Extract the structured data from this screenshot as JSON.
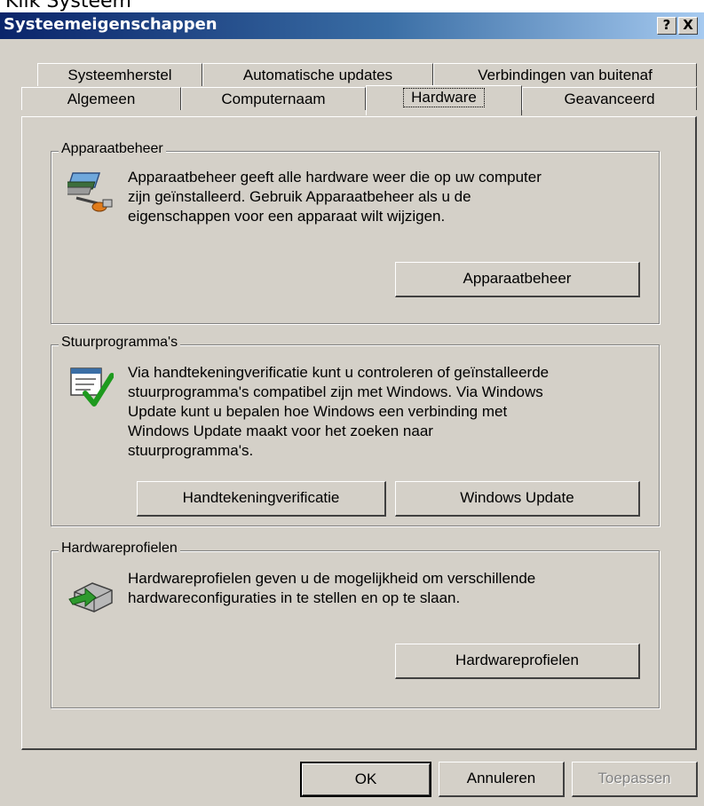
{
  "caption_fragment": "Klik Systeem",
  "window": {
    "title": "Systeemeigenschappen",
    "help_glyph": "?",
    "close_glyph": "X"
  },
  "tabs": {
    "row_back": [
      "Systeemherstel",
      "Automatische updates",
      "Verbindingen van buitenaf"
    ],
    "row_front": [
      "Algemeen",
      "Computernaam",
      "Hardware",
      "Geavanceerd"
    ],
    "active": "Hardware"
  },
  "device_manager": {
    "legend": "Apparaatbeheer",
    "icon": "device-manager-icon",
    "text_lines": [
      "Apparaatbeheer geeft alle hardware weer die op uw computer",
      "zijn geïnstalleerd. Gebruik Apparaatbeheer als u de",
      "eigenschappen voor een apparaat wilt wijzigen."
    ],
    "button": "Apparaatbeheer"
  },
  "drivers": {
    "legend": "Stuurprogramma's",
    "icon": "driver-signing-icon",
    "text_lines": [
      "Via handtekeningverificatie kunt u controleren of geïnstalleerde",
      "stuurprogramma's compatibel zijn met Windows. Via Windows",
      "Update kunt u bepalen hoe Windows een verbinding met",
      "Windows Update maakt voor het zoeken naar",
      "stuurprogramma's."
    ],
    "button_signing": "Handtekeningverificatie",
    "button_update": "Windows Update"
  },
  "hardware_profiles": {
    "legend": "Hardwareprofielen",
    "icon": "hardware-profiles-icon",
    "text_lines": [
      "Hardwareprofielen geven u de mogelijkheid om verschillende",
      "hardwareconfiguraties in te stellen en op te slaan."
    ],
    "button": "Hardwareprofielen"
  },
  "footer": {
    "ok": "OK",
    "cancel": "Annuleren",
    "apply": "Toepassen",
    "apply_enabled": false
  },
  "colors": {
    "titlebar_start": "#0a246a",
    "titlebar_end": "#a6caf0",
    "dialog_face": "#d4d0c8"
  }
}
